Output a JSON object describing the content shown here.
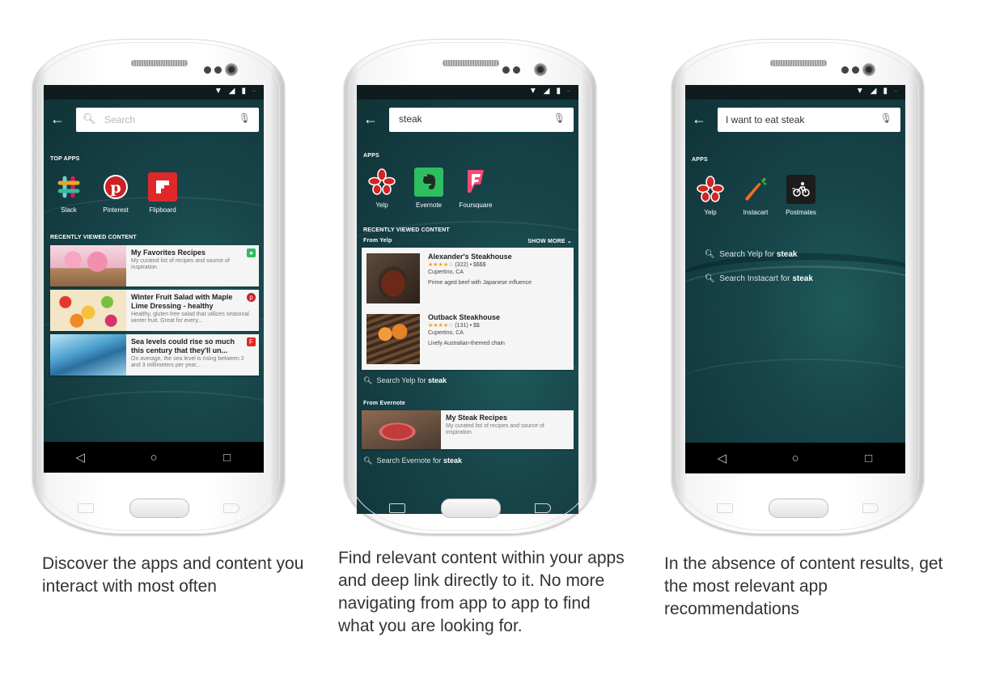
{
  "captions": [
    "Discover the apps and content you interact with most often",
    "Find relevant content within your apps and deep link directly to it. No more navigating from app to app to find what you are looking for.",
    "In the absence of content results, get the most relevant app recommendations"
  ],
  "phone1": {
    "search_placeholder": "Search",
    "top_apps_header": "TOP APPS",
    "apps": [
      "Slack",
      "Pinterest",
      "Flipboard"
    ],
    "recent_header": "RECENTLY VIEWED CONTENT",
    "cards": [
      {
        "title": "My Favorites Recipes",
        "desc": "My curated list of recipes and source of inspiration"
      },
      {
        "title": "Winter Fruit Salad with Maple Lime Dressing - healthy",
        "desc": "Healthy, gluten free salad that utilizes seasonal winter fruit. Great for every..."
      },
      {
        "title": "Sea levels could rise so much this century that they'll un...",
        "desc": "On average, the sea level is rising between 2 and 3 millimeters per year..."
      }
    ]
  },
  "phone2": {
    "search_value": "steak",
    "apps_header": "APPS",
    "apps": [
      "Yelp",
      "Evernote",
      "Foursquare"
    ],
    "recent_header": "RECENTLY VIEWED CONTENT",
    "from_yelp": "From Yelp",
    "show_more": "SHOW MORE",
    "results": [
      {
        "name": "Alexander's Steakhouse",
        "rating": "★★★★☆",
        "meta": "(322) • $$$$",
        "location": "Cupertino, CA",
        "desc": "Prime aged beef with Japanese influence"
      },
      {
        "name": "Outback Steakhouse",
        "rating": "★★★★☆",
        "meta": "(131) • $$",
        "location": "Cupertino, CA",
        "desc": "Lively Australian-themed chain"
      }
    ],
    "search_yelp_prefix": "Search Yelp for ",
    "search_term": "steak",
    "from_evernote": "From Evernote",
    "evernote_card": {
      "title": "My Steak Recipes",
      "desc": "My curated list of recipes and source of inspiration"
    },
    "search_evernote_prefix": "Search Evernote for "
  },
  "phone3": {
    "search_value": "I want to eat steak",
    "apps_header": "APPS",
    "apps": [
      "Yelp",
      "Instacart",
      "Postmates"
    ],
    "suggestions": [
      {
        "prefix": "Search Yelp for ",
        "term": "steak"
      },
      {
        "prefix": "Search Instacart for ",
        "term": "steak"
      }
    ]
  },
  "colors": {
    "slack": "#ffffff",
    "pinterest": "#cb2027",
    "flipboard": "#e12828",
    "yelp": "#d32323",
    "evernote": "#2dbe60",
    "foursquare": "#f94877",
    "instacart": "#f36d21",
    "postmates": "#1c1c1c"
  }
}
